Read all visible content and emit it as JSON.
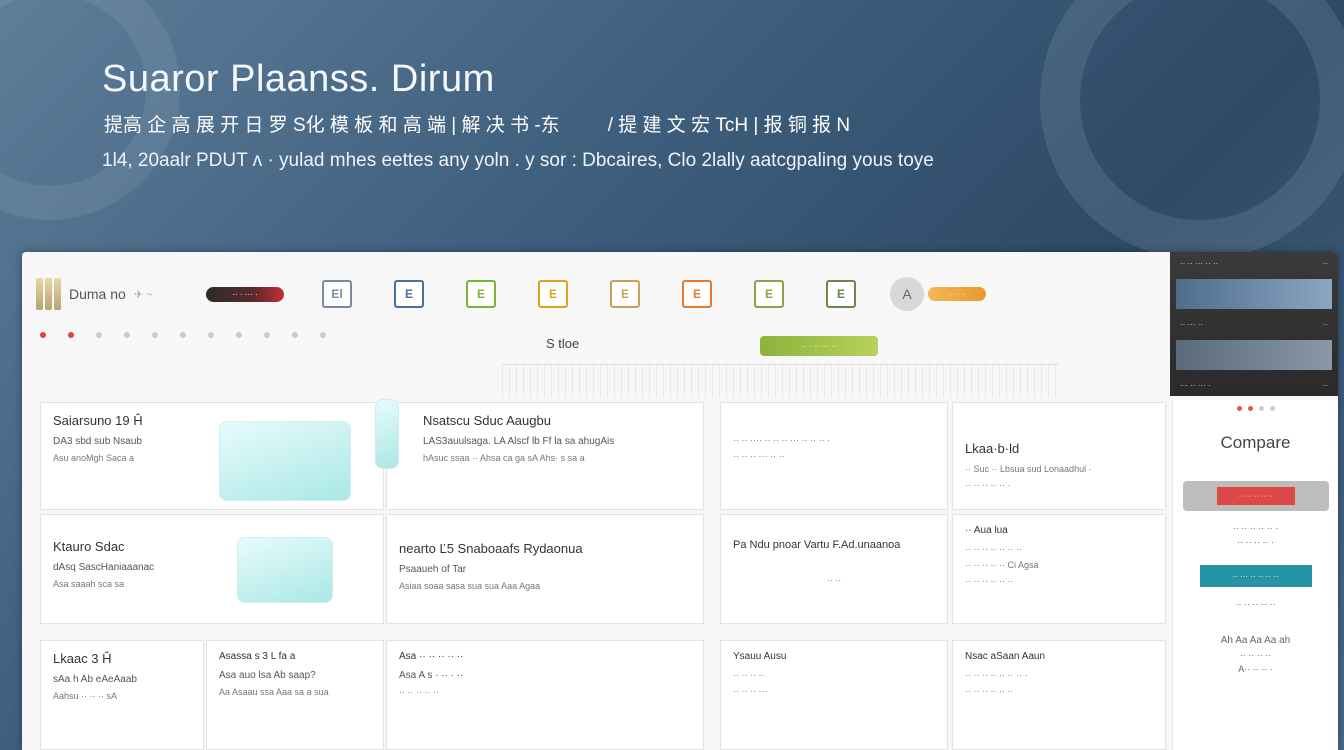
{
  "hero": {
    "title": "Suaror Plaanss. Dirum",
    "subtitle_left": "提高 企 高 展 开 日 罗 S化 模 板 和 高 端 | 解 决 书 -东",
    "subtitle_right": "/ 提 建 文 宏 TcH | 报 铜 报 N",
    "description": "1l4, 20aalr PDUT ᴧ · yulad mhes eettes any yoln . y sor : Dbcaires, Clo 2lally aatcgpaling yous toye"
  },
  "toolbar": {
    "brand_name": "Duma no",
    "brand_sub": "✈ ~",
    "red_pill_label": "·· · ··· ·",
    "tools": [
      {
        "label": "El",
        "color": "#7a8a9a"
      },
      {
        "label": "E",
        "color": "#4a6f9c"
      },
      {
        "label": "E",
        "color": "#7ab33c"
      },
      {
        "label": "E",
        "color": "#d9a520"
      },
      {
        "label": "E",
        "color": "#c8a05a"
      },
      {
        "label": "E",
        "color": "#e07b30"
      },
      {
        "label": "E",
        "color": "#8aa24a"
      },
      {
        "label": "E",
        "color": "#6b8a4a"
      }
    ],
    "badge_label": "A",
    "orange_pill_label": "·· ·· ··"
  },
  "editor": {
    "style_label": "S tloe",
    "green_button_label": "·· · ·· ··· ··"
  },
  "preview": {
    "rows": [
      "·· ·· ··· ·· ··",
      "·· ··· ··",
      "··· ·· ··· ·"
    ]
  },
  "cards": [
    {
      "title": "Saiarsuno 19 Ĥ",
      "lines": [
        "DA3 sbd sub Nsaub",
        "Asu anoMgh Saca a"
      ]
    },
    {
      "title": "Nsatscu Sduc Aaugbu",
      "lines": [
        "LAS3auulsaga. LA   Alscf lb Ff la sa ahugAis",
        "hAsuc ssaa ·· Ahsa  ca ga sA  Ahs·  s sa a"
      ]
    },
    {
      "title": "",
      "lines": [
        "·· ·· ···· ·· ·· ·· ··· ·· ·· ·· ·",
        "·· ·· ·· ··· ·· ··"
      ]
    },
    {
      "title": "Lkaa·b·ld",
      "lines": [
        "·· Suc ·· Lbsua sud Lonaadhul ·",
        "·· ·· ·· ·· ·· ·"
      ]
    },
    {
      "title": "Ktauro  Sdac",
      "lines": [
        "dAsq SascHaniaaanac",
        "Asa saaah sca sa"
      ]
    },
    {
      "title": "nearto  Ľ5 Snaboaafs   Rydaonua",
      "lines": [
        "Psaaueh of Tar",
        "Asiaa soaa sasa sua sua Aaa Agaa"
      ]
    },
    {
      "title": "",
      "lines": [
        "Pa Ndu pnoar Vartu F.Ad.unaanoa",
        "·· ··"
      ]
    },
    {
      "title": "·· Aua lua",
      "lines": [
        "·· ·· ·· ·· ·· ·· ··",
        "·· ·· ·· ·· ·· Ci Agsa",
        "·· ·· ·· ·· ·· ··"
      ]
    },
    {
      "title": "Lkaac 3 Ĥ",
      "lines": [
        "sAa h Ab eAeAaab",
        "Aahsu ·· ·· ·· sA"
      ]
    },
    {
      "title": "Asassa s 3 L fa a",
      "lines": [
        "Asa auo lsa  Ab saap?",
        "Aa Asaau ssa Aaa sa a sua"
      ]
    },
    {
      "title": "Asa ·· ·· ·· ·· ··",
      "lines": [
        "Asa A s · ·· · ··",
        "·· ·· ·· ·· ··"
      ]
    },
    {
      "title": "Ysauu Ausu",
      "lines": [
        "·· ·· ·· ··",
        "·· ·· ·· ···"
      ]
    },
    {
      "title": "Nsac aSaan Aaun",
      "lines": [
        "·· ·· ·· ·· ·· ·· ·· ·",
        "·· ·· ·· ·· ·· ··"
      ]
    }
  ],
  "compare": {
    "title": "Compare",
    "red_bar_label": "·· ··· ·· ··· ·",
    "lines": [
      "·· ·· ·· ·· ·· ·",
      "·· ·· ·· ·· ·",
      "·· ·· ·· ·· ··"
    ],
    "teal_button_label": "·· ··· ·· ·· ·· ··",
    "footer_lines": [
      "Ah Aa Aa Aa ah",
      "·· ·· ·· ··",
      "A·· ·· ·· ·"
    ]
  }
}
